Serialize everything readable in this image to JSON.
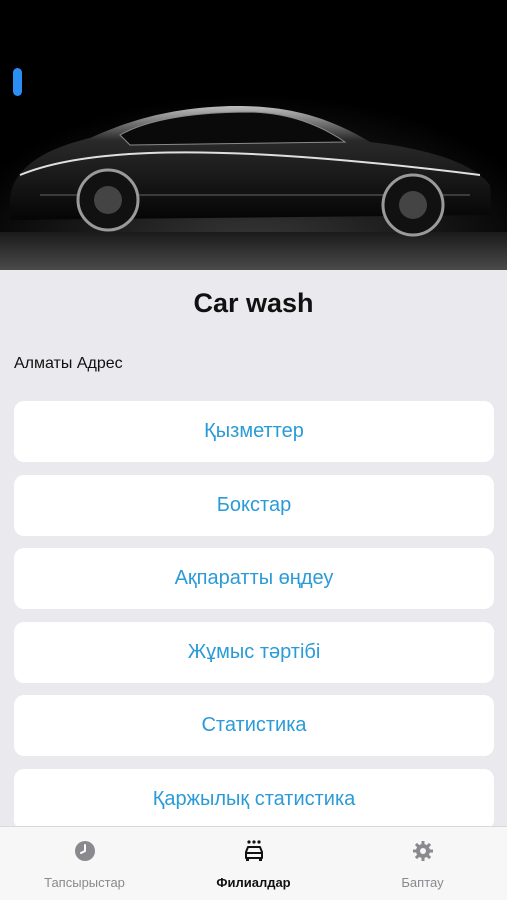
{
  "hero": {
    "image_subject": "black-sedan-car-photo"
  },
  "header": {
    "title": "Car wash",
    "address": "Алматы Адрес"
  },
  "menu": {
    "items": [
      {
        "label": "Қызметтер"
      },
      {
        "label": "Бокстар"
      },
      {
        "label": "Ақпаратты өңдеу"
      },
      {
        "label": "Жұмыс тәртібі"
      },
      {
        "label": "Статистика"
      },
      {
        "label": "Қаржылық статистика"
      }
    ]
  },
  "tabbar": {
    "tabs": [
      {
        "label": "Тапсырыстар",
        "icon": "clock-icon",
        "active": false
      },
      {
        "label": "Филиалдар",
        "icon": "car-wash-icon",
        "active": true
      },
      {
        "label": "Баптау",
        "icon": "gear-icon",
        "active": false
      }
    ]
  },
  "colors": {
    "accent": "#2a9bd8",
    "background": "#e9e9ee",
    "tab_active": "#111111",
    "tab_inactive": "#8a8a8e"
  }
}
